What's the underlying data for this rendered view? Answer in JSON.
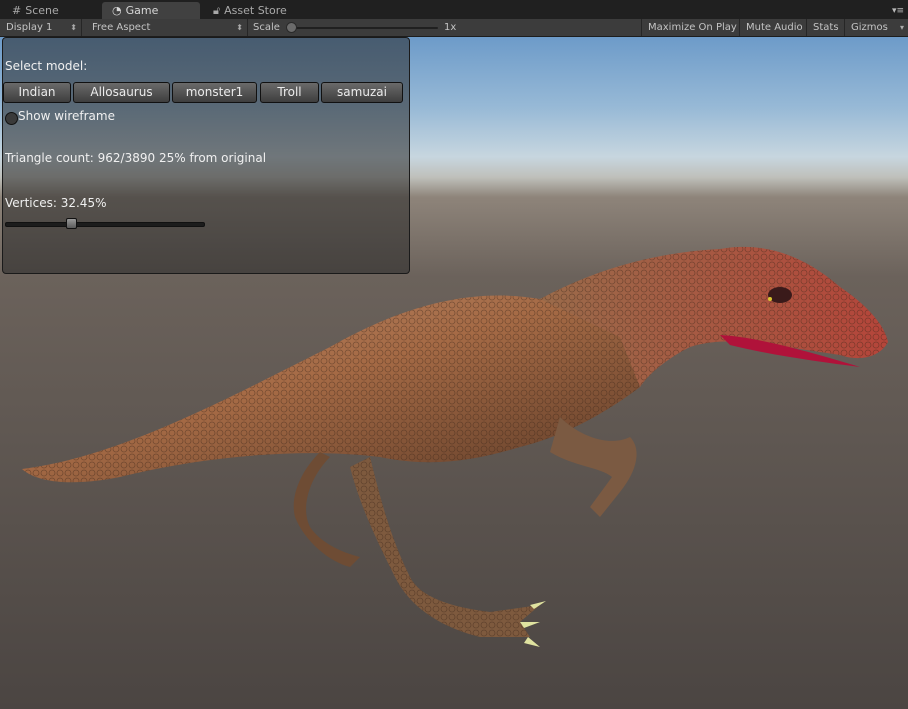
{
  "tabs": [
    {
      "label": "Scene",
      "icon": "grid-icon"
    },
    {
      "label": "Game",
      "icon": "pacman-icon"
    },
    {
      "label": "Asset Store",
      "icon": "lock-icon"
    }
  ],
  "toolbar": {
    "display": "Display 1",
    "aspect": "Free Aspect",
    "scale_label": "Scale",
    "scale_value": "1x",
    "maximize": "Maximize On Play",
    "mute": "Mute Audio",
    "stats": "Stats",
    "gizmos": "Gizmos"
  },
  "gui": {
    "select_label": "Select model:",
    "models": [
      "Indian",
      "Allosaurus",
      "monster1",
      "Troll",
      "samuzai"
    ],
    "wireframe_label": "Show wireframe",
    "triangle_count": "Triangle count: 962/3890 25% from original",
    "vertices_label": "Vertices: 32.45%",
    "vertices_value": 0.3245
  }
}
